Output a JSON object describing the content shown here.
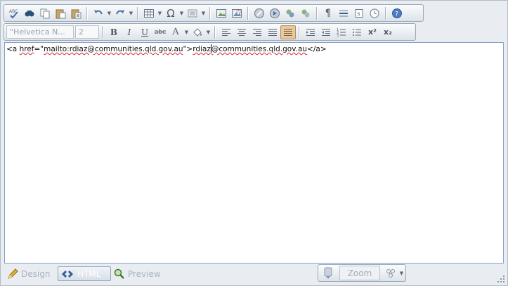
{
  "toolbar_top": {
    "items": [
      "spellcheck-icon",
      "find-icon",
      "copy-icon",
      "paste-icon",
      "paste-text-icon",
      "undo-icon",
      "redo-icon",
      "table-icon",
      "special-char-icon",
      "list-icon",
      "image-icon",
      "image-map-icon",
      "hyperlink-icon",
      "flash-icon",
      "link-manager-icon",
      "unlink-icon",
      "paragraph-icon",
      "horizontal-rule-icon",
      "page-properties-icon",
      "datetime-icon",
      "help-icon"
    ]
  },
  "toolbar_format": {
    "font_name": "\"Helvetica N...",
    "font_size": "2",
    "bold": "B",
    "italic": "I",
    "underline": "U",
    "strike": "abc",
    "font_color": "A",
    "superscript": "x²",
    "subscript": "x₂"
  },
  "content": {
    "tag_open": "<a ",
    "attr_name": "href",
    "attr_eq": "=\"",
    "attr_value": "mailto:rdiaz@communities.qld.gov.au",
    "attr_close": "\">",
    "text_part1": "rdiaz",
    "text_part2": "@communities.qld.gov.au",
    "tag_close": "</a>"
  },
  "modes": {
    "design": "Design",
    "html": "HTML",
    "preview": "Preview"
  },
  "zoom": {
    "label": "Zoom"
  },
  "colors": {
    "accent_border": "#87a1c9",
    "active_button": "#e7c9a0"
  }
}
